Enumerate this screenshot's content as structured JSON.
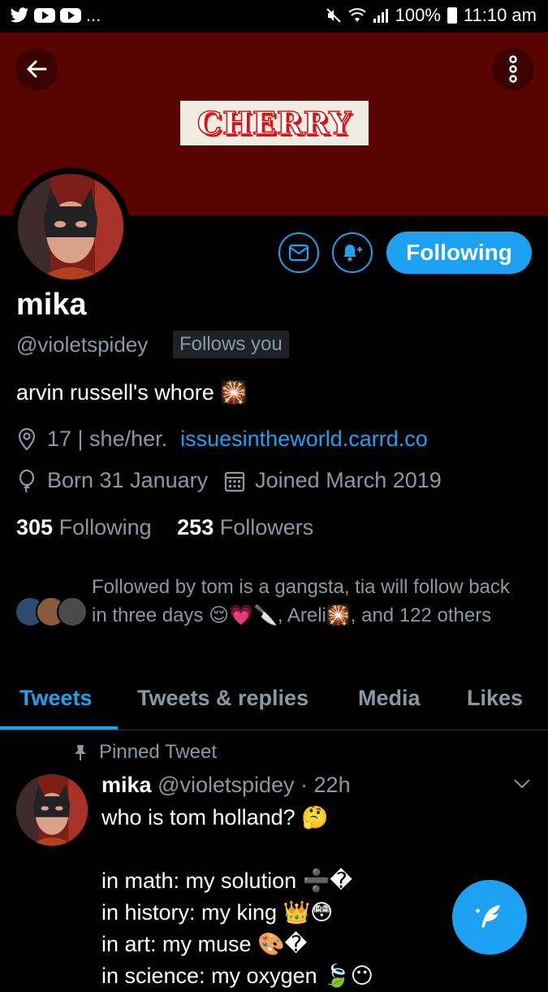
{
  "status_bar": {
    "overflow": "...",
    "battery": "100%",
    "time": "11:10 am"
  },
  "banner": {
    "color": "#5a0402",
    "title": "CHERRY"
  },
  "profile": {
    "display_name": "mika",
    "handle": "@violetspidey",
    "follows_you": "Follows you",
    "bio": "arvin russell's whore 🎇",
    "location": "17 | she/her.",
    "website": "issuesintheworld.carrd.co",
    "birthday": "Born 31 January",
    "joined": "Joined March 2019",
    "following_count": "305",
    "following_label": "Following",
    "followers_count": "253",
    "followers_label": "Followers",
    "followed_by": "Followed by tom is a gangsta, tia will follow back in three days 😌💗🔪, Areli🎇, and 122 others"
  },
  "actions": {
    "following_button": "Following"
  },
  "tabs": [
    {
      "label": "Tweets",
      "active": true
    },
    {
      "label": "Tweets & replies",
      "active": false
    },
    {
      "label": "Media",
      "active": false
    },
    {
      "label": "Likes",
      "active": false
    }
  ],
  "tweet": {
    "pinned_label": "Pinned Tweet",
    "author": "mika",
    "handle_time": "@violetspidey · 22h",
    "text": "who is tom holland? 🤔\n\nin math: my solution ➗�\nin history: my king 👑😳\nin art: my muse 🎨�\nin science: my oxygen 🍃😶"
  },
  "colors": {
    "accent": "#1da1f2",
    "muted": "#8899a6",
    "background": "#000000"
  },
  "icons": [
    "back-arrow-icon",
    "more-vertical-icon",
    "mail-icon",
    "bell-plus-icon",
    "location-pin-icon",
    "balloon-icon",
    "calendar-icon",
    "pin-icon",
    "chevron-down-icon",
    "compose-feather-icon"
  ]
}
